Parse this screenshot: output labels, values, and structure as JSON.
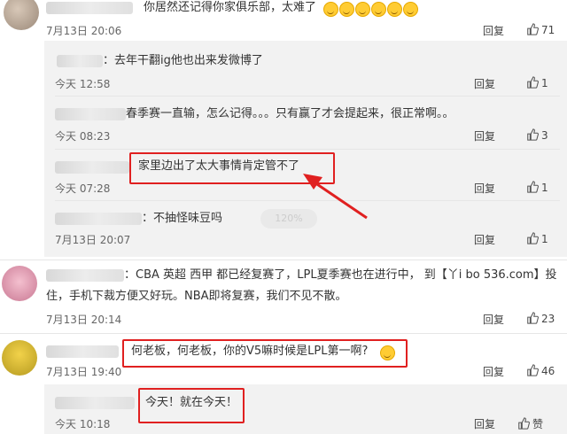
{
  "comments": [
    {
      "text": "你居然还记得你家俱乐部，太难了",
      "time": "7月13日 20:06",
      "reply": "回复",
      "likes": "71"
    },
    {
      "text": "：CBA 英超 西甲 都已经复赛了，LPL夏季赛也在进行中， 到【丫i bo 536.cоm】投",
      "text2": "住，手机下裁方便又好玩。NBA即将复赛，我们不见不散。",
      "time": "7月13日 20:14",
      "reply": "回复",
      "likes": "23"
    },
    {
      "text": "何老板，何老板，你的V5嘛时候是LPL第一啊?",
      "time": "7月13日 19:40",
      "reply": "回复",
      "likes": "46"
    }
  ],
  "replies": [
    {
      "text": "：去年干翻ig他也出来发微博了",
      "time": "今天 12:58",
      "reply": "回复",
      "likes": "1"
    },
    {
      "text": "春季赛一直输，怎么记得。。。只有赢了才会提起来，很正常啊。。",
      "time": "今天 08:23",
      "reply": "回复",
      "likes": "3"
    },
    {
      "text": "家里边出了太大事情肯定管不了",
      "time": "今天 07:28",
      "reply": "回复",
      "likes": "1"
    },
    {
      "text": "：不抽怪味豆吗",
      "time": "7月13日 20:07",
      "reply": "回复",
      "likes": "1",
      "pill": "120%"
    },
    {
      "text": "今天！就在今天！",
      "time": "今天 10:18",
      "reply": "回复",
      "likes": "赞"
    }
  ],
  "colors": {
    "highlight": "#e02020",
    "arrow": "#e02020",
    "panel": "#f2f2f2"
  }
}
